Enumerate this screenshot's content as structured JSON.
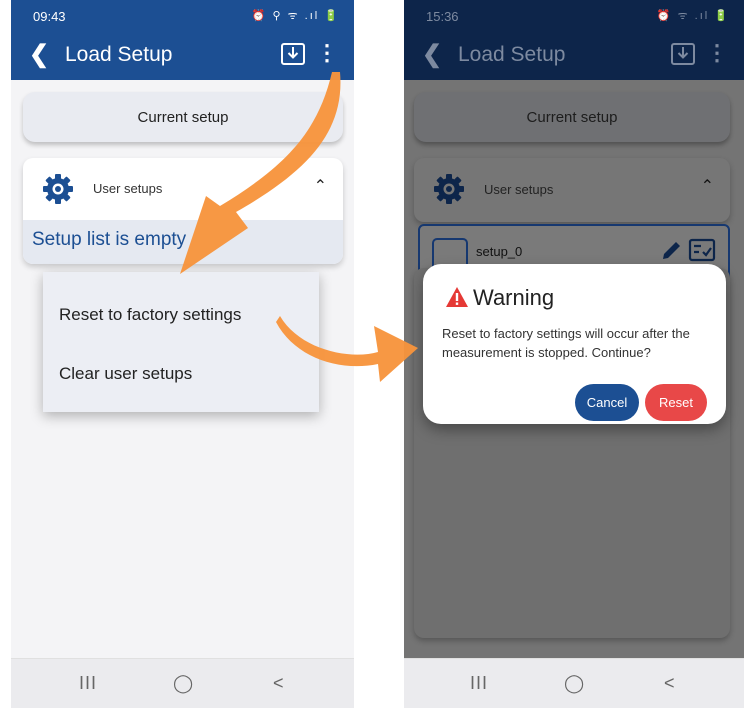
{
  "left": {
    "status_time": "09:43",
    "status_icons": "⏰ ⚲ ᯤ .ıl 🔋",
    "appbar_title": "Load Setup",
    "current_setup_label": "Current setup",
    "user_setups_label": "User setups",
    "empty_text": "Setup list is empty",
    "menu_items": [
      "Reset to factory settings",
      "Clear user setups"
    ]
  },
  "right": {
    "status_time": "15:36",
    "status_icons": "⏰ ᯤ .ıl 🔋",
    "appbar_title": "Load Setup",
    "current_setup_label": "Current setup",
    "user_setups_label": "User setups",
    "setup_item_name": "setup_0",
    "dialog": {
      "title": "Warning",
      "body": "Reset to factory settings will occur after the measurement is stopped. Continue?",
      "cancel_label": "Cancel",
      "reset_label": "Reset"
    }
  },
  "navbar": {
    "recents": "III",
    "home": "◯",
    "back": "<"
  },
  "colors": {
    "brand": "#1c4f93",
    "danger": "#e84848",
    "arrow": "#f7943c"
  }
}
